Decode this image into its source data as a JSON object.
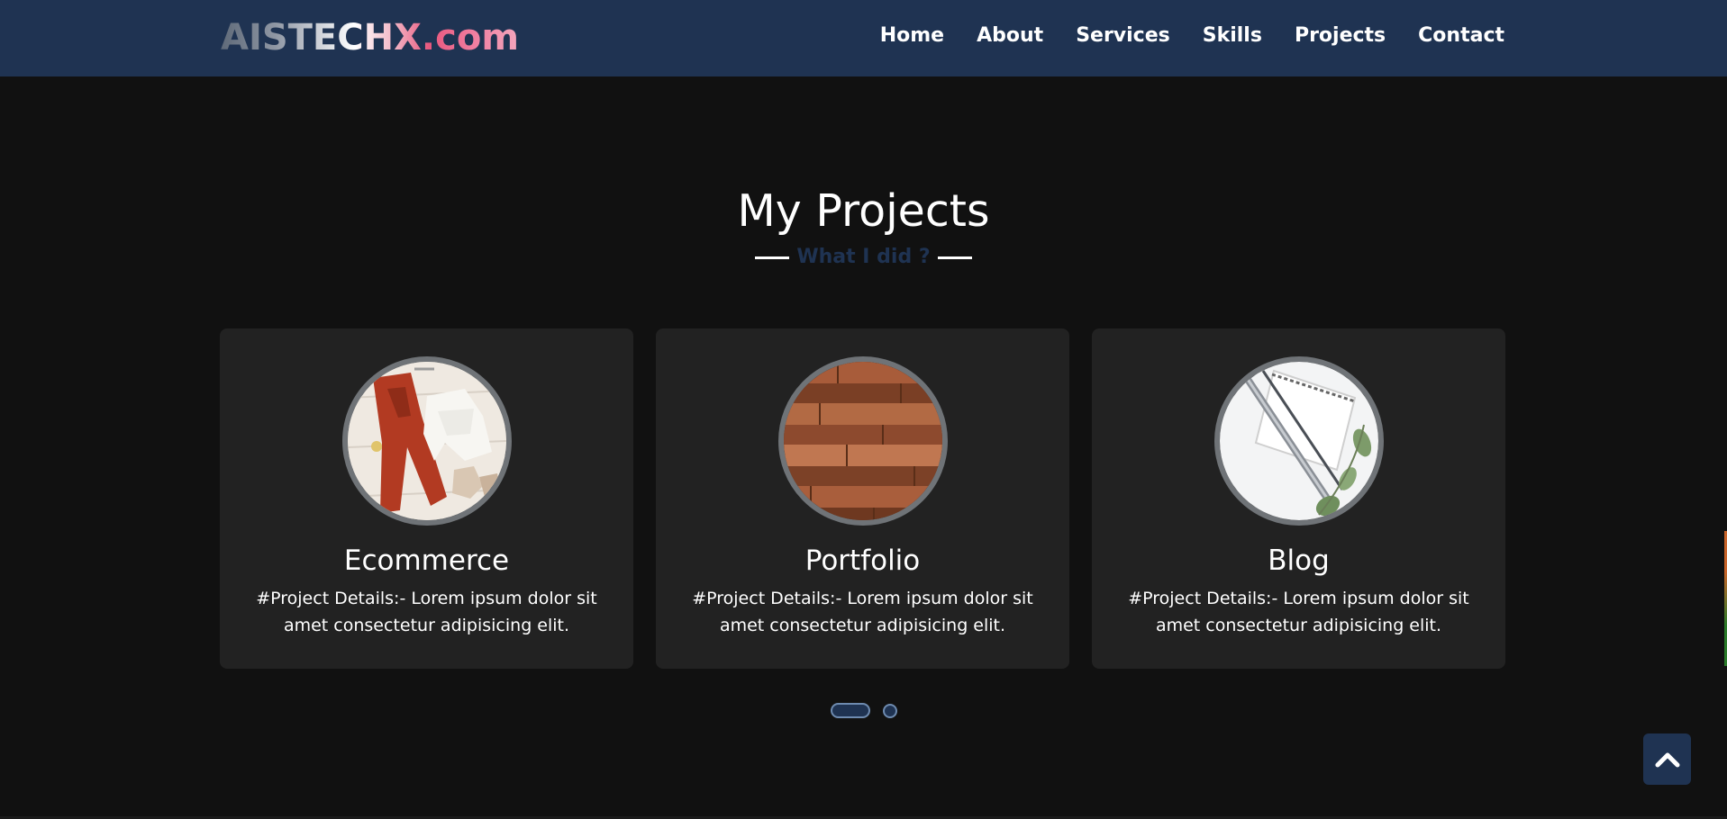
{
  "navbar": {
    "logo": "AISTECHX.com",
    "links": [
      "Home",
      "About",
      "Services",
      "Skills",
      "Projects",
      "Contact"
    ]
  },
  "section": {
    "title": "My Projects",
    "subtitle": "What I did ?"
  },
  "cards": [
    {
      "title": "Ecommerce",
      "description": "#Project Details:- Lorem ipsum dolor sit amet consectetur adipisicing elit."
    },
    {
      "title": "Portfolio",
      "description": "#Project Details:- Lorem ipsum dolor sit amet consectetur adipisicing elit."
    },
    {
      "title": "Blog",
      "description": "#Project Details:- Lorem ipsum dolor sit amet consectetur adipisicing elit."
    }
  ],
  "carousel": {
    "active_index": 0,
    "page_count": 2
  },
  "scroll_top": {
    "icon": "chevron-up-icon"
  },
  "colors": {
    "navbar_bg": "#1f3352",
    "page_bg": "#111111",
    "card_bg": "#222222",
    "subtitle": "#1f3352"
  }
}
